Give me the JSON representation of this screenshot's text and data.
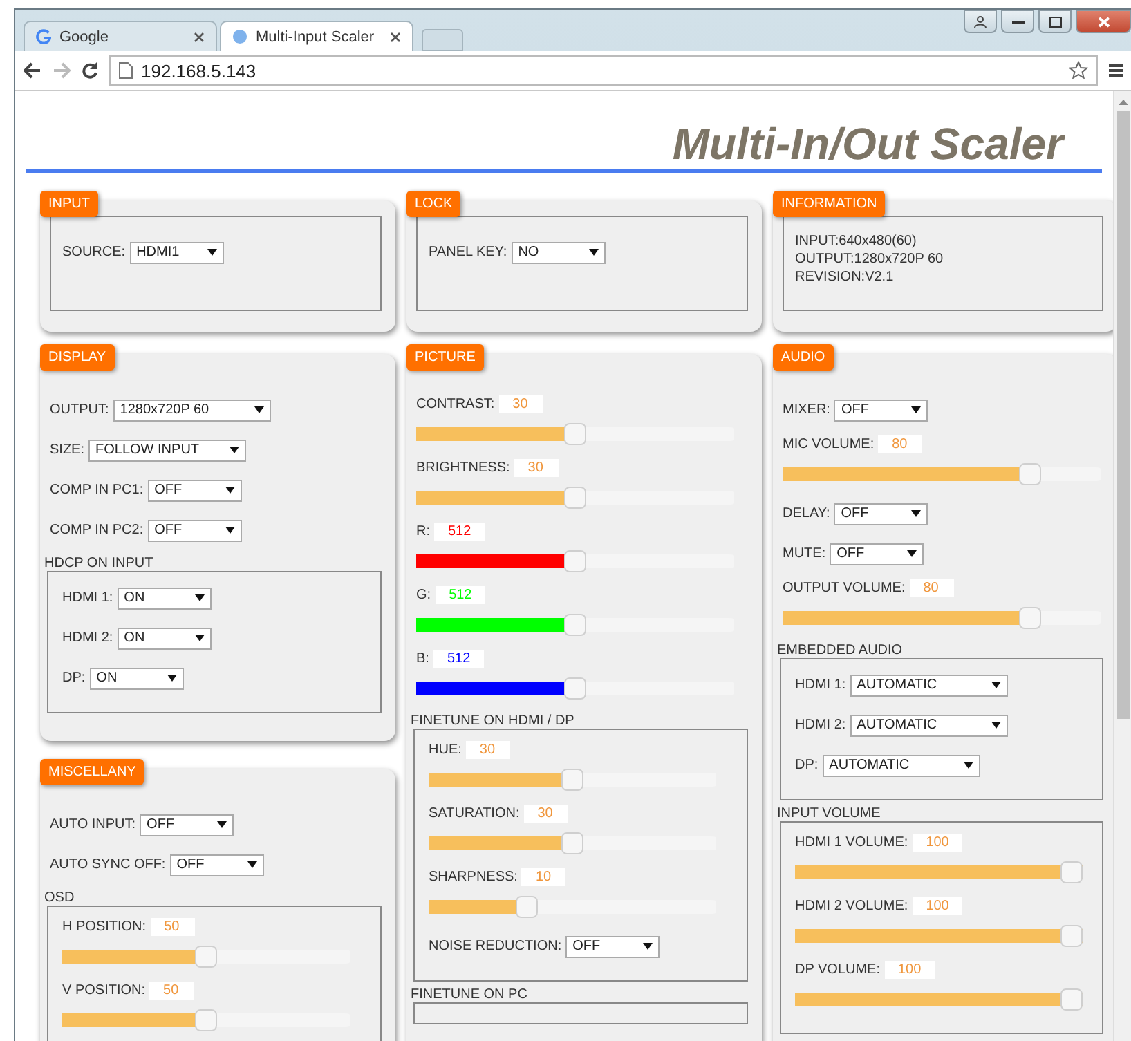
{
  "browser": {
    "tabs": [
      {
        "title": "Google",
        "selected": false
      },
      {
        "title": "Multi-Input Scaler",
        "selected": true
      }
    ],
    "url": "192.168.5.143"
  },
  "page": {
    "title": "Multi-In/Out Scaler"
  },
  "top_panels": [
    {
      "title": "INPUT",
      "items": [
        {
          "kind": "select",
          "label": "SOURCE:",
          "value": "HDMI1"
        }
      ]
    },
    {
      "title": "LOCK",
      "items": [
        {
          "kind": "select",
          "label": "PANEL KEY:",
          "value": "NO"
        }
      ]
    },
    {
      "title": "INFORMATION",
      "items": [
        {
          "kind": "info",
          "lines": [
            "INPUT:640x480(60)",
            "OUTPUT:1280x720P 60",
            "REVISION:V2.1"
          ]
        }
      ]
    }
  ],
  "columns": [
    [
      {
        "title": "DISPLAY",
        "items": [
          {
            "kind": "select",
            "label": "OUTPUT:",
            "value": "1280x720P 60"
          },
          {
            "kind": "select",
            "label": "SIZE:",
            "value": "FOLLOW INPUT"
          },
          {
            "kind": "select",
            "label": "COMP IN PC1:",
            "value": "OFF"
          },
          {
            "kind": "select",
            "label": "COMP IN PC2:",
            "value": "OFF"
          },
          {
            "kind": "group",
            "title": "HDCP ON INPUT",
            "items": [
              {
                "kind": "select",
                "label": "HDMI 1:",
                "value": "ON"
              },
              {
                "kind": "select",
                "label": "HDMI 2:",
                "value": "ON"
              },
              {
                "kind": "select",
                "label": "DP:",
                "value": "ON"
              }
            ]
          }
        ]
      },
      {
        "title": "MISCELLANY",
        "items": [
          {
            "kind": "select",
            "label": "AUTO INPUT:",
            "value": "OFF"
          },
          {
            "kind": "select",
            "label": "AUTO SYNC OFF:",
            "value": "OFF"
          },
          {
            "kind": "group",
            "title": "OSD",
            "items": [
              {
                "kind": "slider",
                "label": "H POSITION:",
                "value": "50",
                "level": 0.5,
                "color": "#f7bf5c"
              },
              {
                "kind": "slider",
                "label": "V POSITION:",
                "value": "50",
                "level": 0.5,
                "color": "#f7bf5c"
              }
            ]
          }
        ]
      }
    ],
    [
      {
        "title": "PICTURE",
        "items": [
          {
            "kind": "slider",
            "label": "CONTRAST:",
            "value": "30",
            "level": 0.5,
            "color": "#f7bf5c"
          },
          {
            "kind": "slider",
            "label": "BRIGHTNESS:",
            "value": "30",
            "level": 0.5,
            "color": "#f7bf5c"
          },
          {
            "kind": "slider",
            "label": "R:",
            "value": "512",
            "level": 0.5,
            "color": "#ff0000"
          },
          {
            "kind": "slider",
            "label": "G:",
            "value": "512",
            "level": 0.5,
            "color": "#00ff00"
          },
          {
            "kind": "slider",
            "label": "B:",
            "value": "512",
            "level": 0.5,
            "color": "#0000ff"
          },
          {
            "kind": "group",
            "title": "FINETUNE ON HDMI / DP",
            "items": [
              {
                "kind": "slider",
                "label": "HUE:",
                "value": "30",
                "level": 0.5,
                "color": "#f7bf5c"
              },
              {
                "kind": "slider",
                "label": "SATURATION:",
                "value": "30",
                "level": 0.5,
                "color": "#f7bf5c"
              },
              {
                "kind": "slider",
                "label": "SHARPNESS:",
                "value": "10",
                "level": 0.33,
                "color": "#f7bf5c"
              },
              {
                "kind": "select",
                "label": "NOISE REDUCTION:",
                "value": "OFF"
              }
            ]
          },
          {
            "kind": "group",
            "title": "FINETUNE ON PC"
          }
        ]
      }
    ],
    [
      {
        "title": "AUDIO",
        "items": [
          {
            "kind": "select",
            "label": "MIXER:",
            "value": "OFF"
          },
          {
            "kind": "slider",
            "label": "MIC VOLUME:",
            "value": "80",
            "level": 0.8,
            "color": "#f7bf5c"
          },
          {
            "kind": "select",
            "label": "DELAY:",
            "value": "OFF"
          },
          {
            "kind": "select",
            "label": "MUTE:",
            "value": "OFF"
          },
          {
            "kind": "slider",
            "label": "OUTPUT VOLUME:",
            "value": "80",
            "level": 0.8,
            "color": "#f7bf5c"
          },
          {
            "kind": "group",
            "title": "EMBEDDED AUDIO",
            "items": [
              {
                "kind": "select",
                "label": "HDMI 1:",
                "value": "AUTOMATIC"
              },
              {
                "kind": "select",
                "label": "HDMI 2:",
                "value": "AUTOMATIC"
              },
              {
                "kind": "select",
                "label": "DP:",
                "value": "AUTOMATIC"
              }
            ]
          },
          {
            "kind": "group",
            "title": "INPUT VOLUME",
            "items": [
              {
                "kind": "slider",
                "label": "HDMI 1 VOLUME:",
                "value": "100",
                "level": 1,
                "color": "#f7bf5c"
              },
              {
                "kind": "slider",
                "label": "HDMI 2 VOLUME:",
                "value": "100",
                "level": 1,
                "color": "#f7bf5c"
              },
              {
                "kind": "slider",
                "label": "DP VOLUME:",
                "value": "100",
                "level": 1,
                "color": "#f7bf5c"
              }
            ]
          }
        ]
      }
    ]
  ]
}
